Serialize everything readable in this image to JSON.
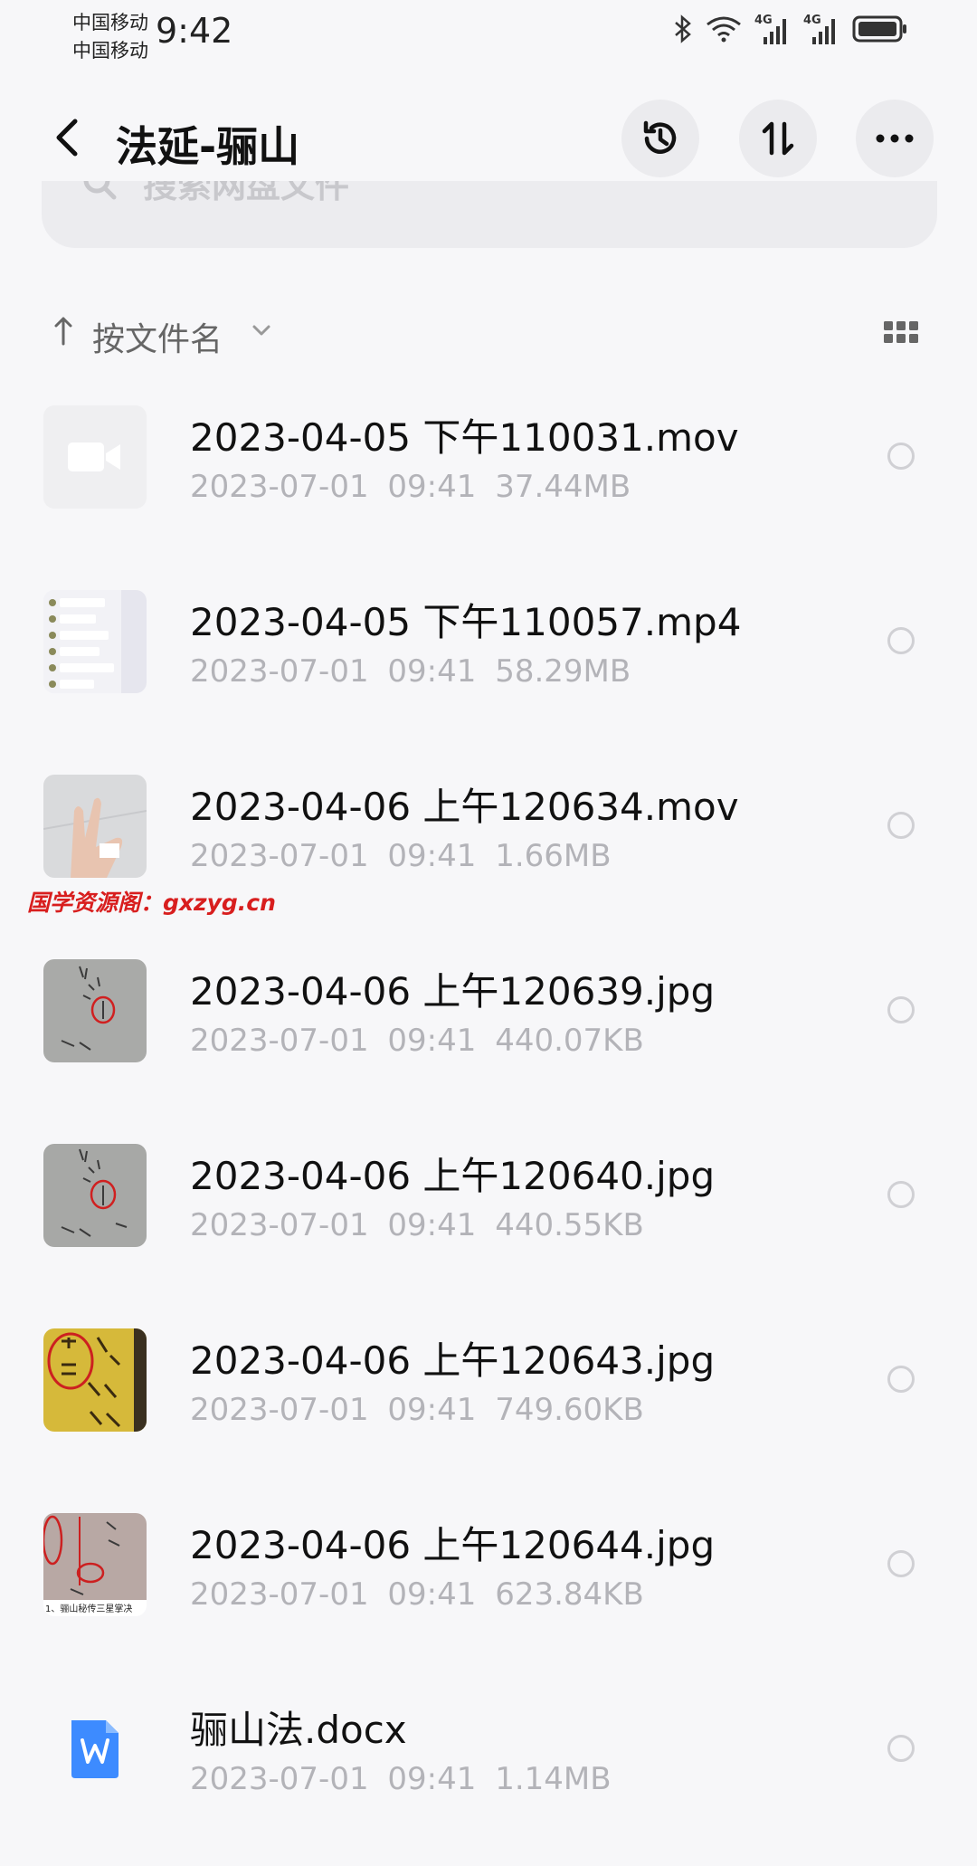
{
  "status_bar": {
    "carrier1": "中国移动",
    "carrier2": "中国移动",
    "time": "9:42",
    "net1": "4G",
    "net2": "4G"
  },
  "header": {
    "title": "法延-骊山",
    "back_icon": "back-chevron-icon",
    "history_icon": "history-clock-icon",
    "sort_icon": "sort-updown-icon",
    "more_icon": "more-dots-icon"
  },
  "search": {
    "placeholder": "搜索网盘文件"
  },
  "sort": {
    "label": "按文件名"
  },
  "watermark": "国学资源阁：gxzyg.cn",
  "files": [
    {
      "name": "2023-04-05 下午110031.mov",
      "date": "2023-07-01",
      "time": "09:41",
      "size": "37.44MB",
      "thumb": "video-placeholder-icon"
    },
    {
      "name": "2023-04-05 下午110057.mp4",
      "date": "2023-07-01",
      "time": "09:41",
      "size": "58.29MB",
      "thumb": "chat-screenshot"
    },
    {
      "name": "2023-04-06 上午120634.mov",
      "date": "2023-07-01",
      "time": "09:41",
      "size": "1.66MB",
      "thumb": "hand-photo"
    },
    {
      "name": "2023-04-06 上午120639.jpg",
      "date": "2023-07-01",
      "time": "09:41",
      "size": "440.07KB",
      "thumb": "handwriting-photo"
    },
    {
      "name": "2023-04-06 上午120640.jpg",
      "date": "2023-07-01",
      "time": "09:41",
      "size": "440.55KB",
      "thumb": "handwriting-photo"
    },
    {
      "name": "2023-04-06 上午120643.jpg",
      "date": "2023-07-01",
      "time": "09:41",
      "size": "749.60KB",
      "thumb": "yellow-paper-photo"
    },
    {
      "name": "2023-04-06 上午120644.jpg",
      "date": "2023-07-01",
      "time": "09:41",
      "size": "623.84KB",
      "thumb": "document-photo",
      "thumb_caption": "1、骊山秘传三星掌决"
    },
    {
      "name": "骊山法.docx",
      "date": "2023-07-01",
      "time": "09:41",
      "size": "1.14MB",
      "thumb": "word-doc-icon"
    }
  ]
}
